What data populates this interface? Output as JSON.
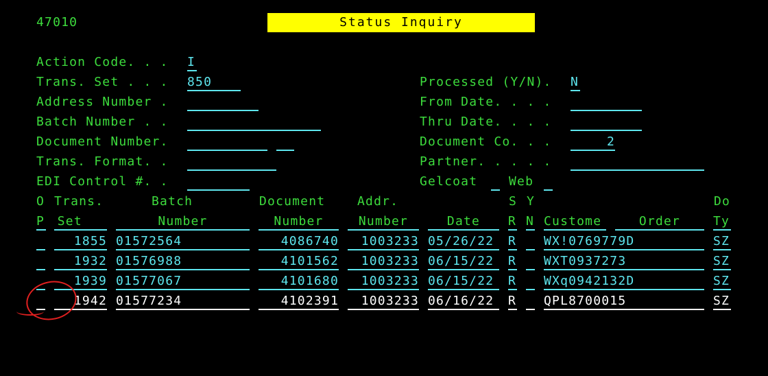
{
  "screen": {
    "id": "47010",
    "title": "Status Inquiry"
  },
  "form": {
    "action_code_label": "Action Code. . .",
    "action_code_value": "I",
    "trans_set_label": "Trans. Set . . .",
    "trans_set_value": "850",
    "address_number_label": "Address Number .",
    "address_number_value": "",
    "batch_number_label": "Batch Number . .",
    "batch_number_value": "",
    "document_number_label": "Document Number.",
    "document_number_value": "",
    "document_type_value": "",
    "trans_format_label": "Trans. Format. .",
    "trans_format_value": "",
    "edi_control_label": "EDI Control #. .",
    "edi_control_value": "",
    "processed_label": "Processed (Y/N).",
    "processed_value": "N",
    "from_date_label": "From Date. . . .",
    "from_date_value": "",
    "thru_date_label": "Thru Date. . . .",
    "thru_date_value": "",
    "document_co_label": "Document Co. . .",
    "document_co_value": "2",
    "partner_label": "Partner. . . . .",
    "partner_value": "",
    "gelcoat_label": "Gelcoat",
    "gelcoat_value": "",
    "web_label": "Web",
    "web_value": ""
  },
  "table": {
    "headers_top": {
      "op": "O",
      "trans": "Trans.",
      "batch": "Batch",
      "document": "Document",
      "addr": "Addr.",
      "sr": "S",
      "yn": "Y",
      "doc_type": "Do"
    },
    "headers_bottom": {
      "op": "P",
      "trans": "Set",
      "batch": "Number",
      "document": "Number",
      "addr": "Number",
      "date": "Date",
      "sr": "R",
      "yn": "N",
      "customer": "Custome",
      "order": "Order",
      "doc_type": "Ty"
    },
    "rows": [
      {
        "op": "",
        "trans_set": "1855",
        "batch": "01572564",
        "document": "4086740",
        "addr": "1003233",
        "date": "05/26/22",
        "sr": "R",
        "yn": "",
        "customer_order": "WX!0769779D",
        "doc_type": "SZ"
      },
      {
        "op": "",
        "trans_set": "1932",
        "batch": "01576988",
        "document": "4101562",
        "addr": "1003233",
        "date": "06/15/22",
        "sr": "R",
        "yn": "",
        "customer_order": "WXT0937273",
        "doc_type": "SZ"
      },
      {
        "op": "",
        "trans_set": "1939",
        "batch": "01577067",
        "document": "4101680",
        "addr": "1003233",
        "date": "06/15/22",
        "sr": "R",
        "yn": "",
        "customer_order": "WXq0942132D",
        "doc_type": "SZ"
      },
      {
        "op": "",
        "trans_set": "1942",
        "batch": "01577234",
        "document": "4102391",
        "addr": "1003233",
        "date": "06/16/22",
        "sr": "R",
        "yn": "",
        "customer_order": "QPL8700015",
        "doc_type": "SZ"
      }
    ]
  },
  "colors": {
    "background": "#000000",
    "label": "#3ddc3d",
    "field": "#5ee6ee",
    "title_bg": "#ffff00",
    "annotation": "#e02020"
  }
}
